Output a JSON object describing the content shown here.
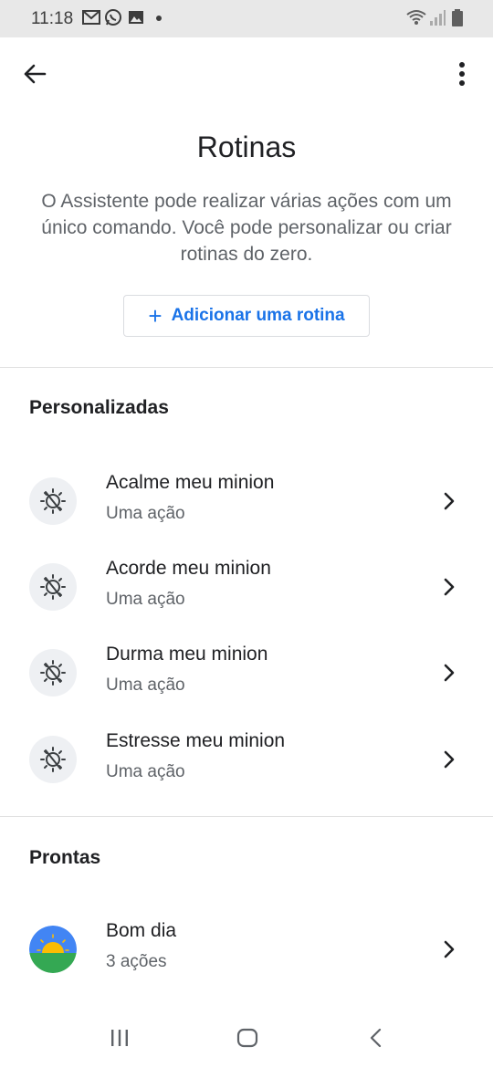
{
  "status_bar": {
    "time": "11:18",
    "left_icons": [
      "gmail-icon",
      "whatsapp-icon",
      "gallery-icon",
      "notification-dot"
    ],
    "right_icons": [
      "wifi-icon",
      "signal-icon",
      "battery-icon"
    ]
  },
  "app_bar": {
    "back_icon": "arrow-back-icon",
    "menu_icon": "more-vert-icon"
  },
  "page": {
    "title": "Rotinas",
    "description": "O Assistente pode realizar várias ações com um único comando. Você pode personalizar ou criar rotinas do zero.",
    "add_button": {
      "icon": "+",
      "label": "Adicionar uma rotina",
      "color": "#1a73e8"
    }
  },
  "sections": {
    "custom": {
      "heading": "Personalizadas",
      "items": [
        {
          "title": "Acalme meu minion",
          "subtitle": "Uma ação",
          "icon": "routine-sun-icon"
        },
        {
          "title": "Acorde meu minion",
          "subtitle": "Uma ação",
          "icon": "routine-sun-icon"
        },
        {
          "title": "Durma meu minion",
          "subtitle": "Uma ação",
          "icon": "routine-sun-icon"
        },
        {
          "title": "Estresse meu minion",
          "subtitle": "Uma ação",
          "icon": "routine-sun-icon"
        }
      ]
    },
    "ready": {
      "heading": "Prontas",
      "items": [
        {
          "title": "Bom dia",
          "subtitle": "3 ações",
          "icon": "sunrise-icon"
        }
      ]
    }
  },
  "nav_bar": {
    "icons": [
      "recent-apps-icon",
      "home-icon",
      "back-icon"
    ]
  },
  "colors": {
    "accent": "#1a73e8",
    "text_primary": "#202124",
    "text_secondary": "#5f6368",
    "sunrise_sky": "#4285f4",
    "sunrise_sun": "#fbbc04",
    "sunrise_ground": "#34a853"
  }
}
